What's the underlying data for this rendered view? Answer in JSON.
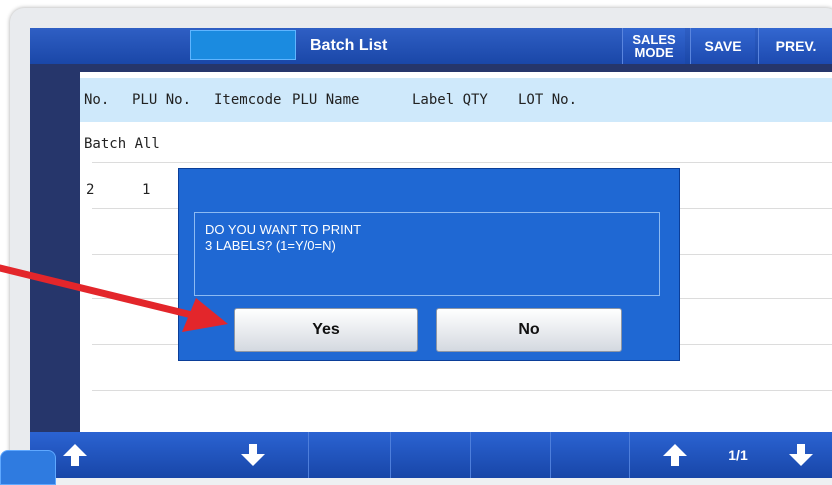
{
  "topbar": {
    "title": "Batch List",
    "sales_mode": "SALES\nMODE",
    "save": "SAVE",
    "prev": "PREV."
  },
  "table": {
    "headers": [
      "No.",
      "PLU No.",
      "Itemcode",
      "PLU Name",
      "Label QTY",
      "LOT No."
    ],
    "rows": [
      {
        "no": "Batch All",
        "plu": ""
      },
      {
        "no": "2",
        "plu": "1"
      }
    ]
  },
  "dialog": {
    "line1": "DO YOU WANT TO PRINT",
    "line2": "3 LABELS? (1=Y/0=N)",
    "yes": "Yes",
    "no": "No"
  },
  "bottombar": {
    "page": "1/1",
    "icons": [
      "up-arrow-icon",
      "down-arrow-icon",
      "up-arrow-icon",
      "down-arrow-icon"
    ]
  },
  "colors": {
    "accent_blue": "#1f68d3",
    "header_row": "#cfe9fb",
    "annotation_arrow": "#e3262b"
  }
}
